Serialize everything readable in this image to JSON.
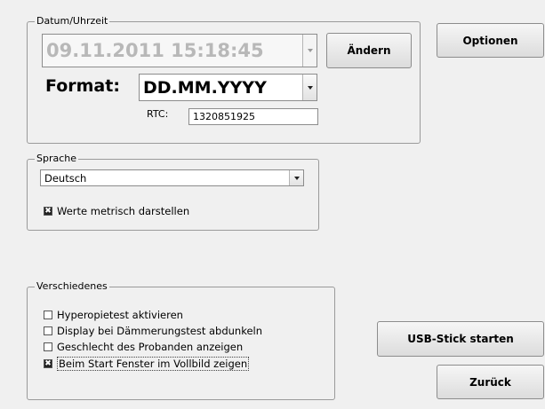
{
  "datetime_group": {
    "title": "Datum/Uhrzeit",
    "datetime_value": "09.11.2011 15:18:45",
    "change_label": "Ändern",
    "format_label": "Format:",
    "format_value": "DD.MM.YYYY",
    "rtc_label": "RTC:",
    "rtc_value": "1320851925"
  },
  "options_label": "Optionen",
  "language_group": {
    "title": "Sprache",
    "selected_language": "Deutsch",
    "metric_label": "Werte metrisch darstellen",
    "metric_checked": true
  },
  "misc_group": {
    "title": "Verschiedenes",
    "items": [
      {
        "label": "Hyperopietest aktivieren",
        "checked": false
      },
      {
        "label": "Display bei Dämmerungstest abdunkeln",
        "checked": false
      },
      {
        "label": "Geschlecht des Probanden anzeigen",
        "checked": false
      },
      {
        "label": "Beim Start Fenster im Vollbild zeigen",
        "checked": true
      }
    ]
  },
  "usb_label": "USB-Stick starten",
  "back_label": "Zurück"
}
